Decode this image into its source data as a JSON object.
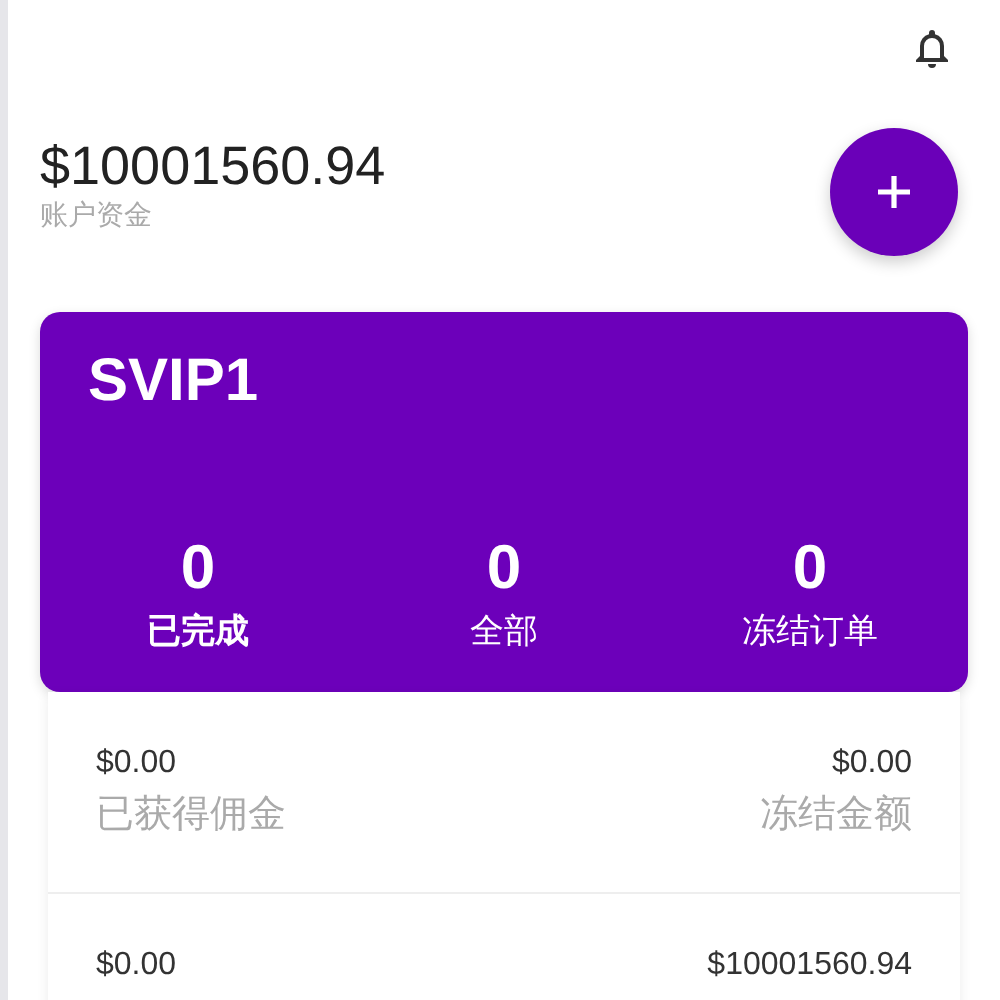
{
  "balance": {
    "amount": "$10001560.94",
    "label": "账户资金"
  },
  "level_card": {
    "title": "SVIP1",
    "stats": [
      {
        "value": "0",
        "label": "已完成"
      },
      {
        "value": "0",
        "label": "全部"
      },
      {
        "value": "0",
        "label": "冻结订单"
      }
    ]
  },
  "summary_rows": [
    {
      "left": {
        "value": "$0.00",
        "label": "已获得佣金"
      },
      "right": {
        "value": "$0.00",
        "label": "冻结金额"
      }
    },
    {
      "left": {
        "value": "$0.00"
      },
      "right": {
        "value": "$10001560.94"
      }
    }
  ]
}
